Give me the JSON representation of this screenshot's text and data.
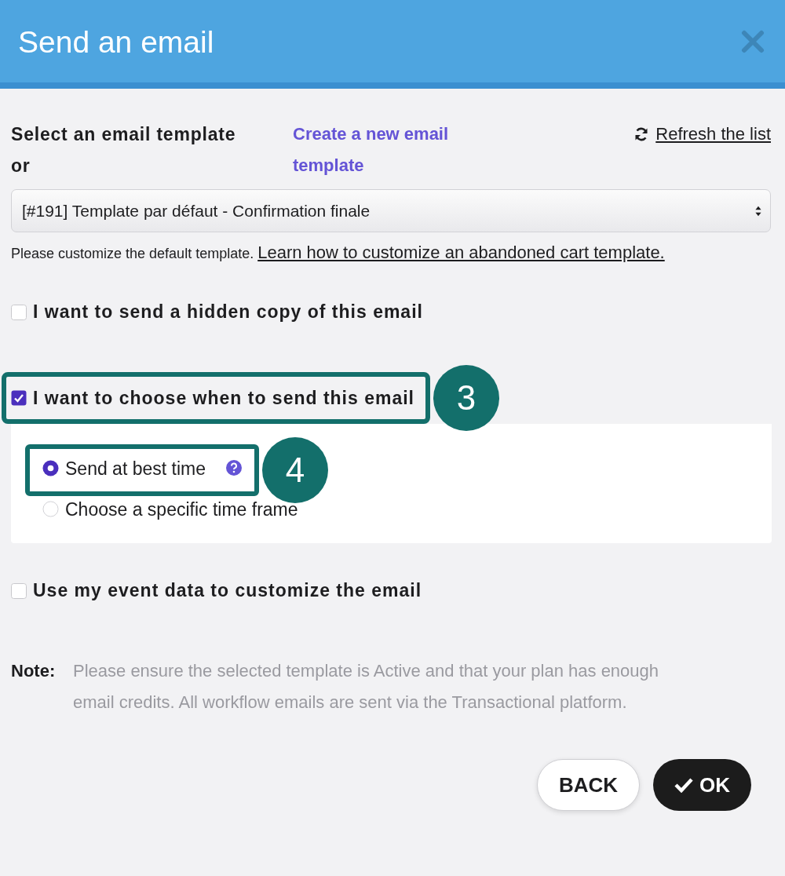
{
  "dialog": {
    "title": "Send an email"
  },
  "template": {
    "label": "Select an email template or",
    "create_link": "Create a new email template",
    "refresh_link": "Refresh the list",
    "select_value": "[#191] Template par défaut - Confirmation finale",
    "hint": "Please customize the default template.",
    "hint_link": "Learn how to customize an abandoned cart template."
  },
  "options": [
    {
      "label": "I want to send a hidden copy of this email",
      "checked": false
    },
    {
      "label": "I want to choose when to send this email",
      "checked": true,
      "callout": "3",
      "radios": [
        {
          "label": "Send at best time",
          "selected": true,
          "help": true,
          "callout": "4"
        },
        {
          "label": "Choose a specific time frame",
          "selected": false,
          "help": false
        }
      ]
    },
    {
      "label": "Use my event data to customize the email",
      "checked": false
    }
  ],
  "note": {
    "label": "Note:",
    "text": "Please ensure the selected template is Active and that your plan has enough email credits. All workflow emails are sent via the Transactional platform."
  },
  "buttons": [
    {
      "label": "BACK",
      "kind": "secondary"
    },
    {
      "label": "OK",
      "kind": "primary"
    }
  ]
}
